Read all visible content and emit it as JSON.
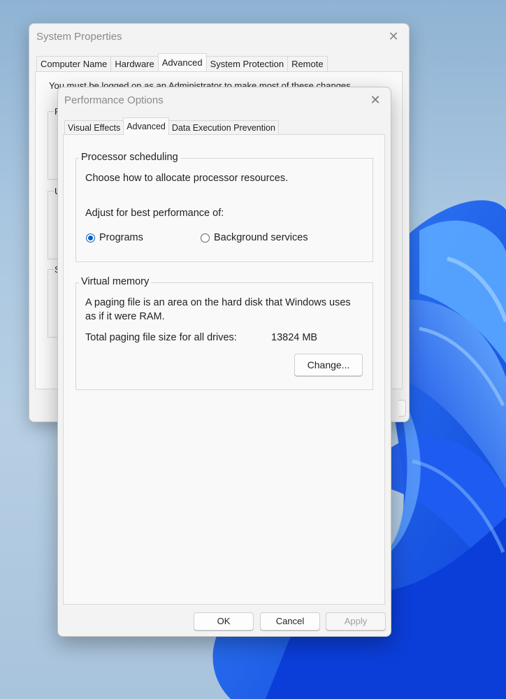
{
  "system_properties": {
    "title": "System Properties",
    "tabs": [
      "Computer Name",
      "Hardware",
      "Advanced",
      "System Protection",
      "Remote"
    ],
    "active_tab": "Advanced",
    "admin_notice": "You must be logged on as an Administrator to make most of these changes.",
    "group_initials": [
      "P",
      "U",
      "S"
    ]
  },
  "performance_options": {
    "title": "Performance Options",
    "tabs": [
      "Visual Effects",
      "Advanced",
      "Data Execution Prevention"
    ],
    "active_tab": "Advanced",
    "processor_scheduling": {
      "legend": "Processor scheduling",
      "description": "Choose how to allocate processor resources.",
      "adjust_label": "Adjust for best performance of:",
      "options": [
        {
          "label": "Programs",
          "selected": true
        },
        {
          "label": "Background services",
          "selected": false
        }
      ]
    },
    "virtual_memory": {
      "legend": "Virtual memory",
      "description_line1": "A paging file is an area on the hard disk that Windows uses",
      "description_line2": "as if it were RAM.",
      "total_label": "Total paging file size for all drives:",
      "total_value": "13824 MB",
      "change_button": "Change..."
    },
    "buttons": {
      "ok": "OK",
      "cancel": "Cancel",
      "apply": "Apply"
    }
  },
  "colors": {
    "accent": "#0a5fc2",
    "wallpaper_blue": "#1a5ff0"
  }
}
